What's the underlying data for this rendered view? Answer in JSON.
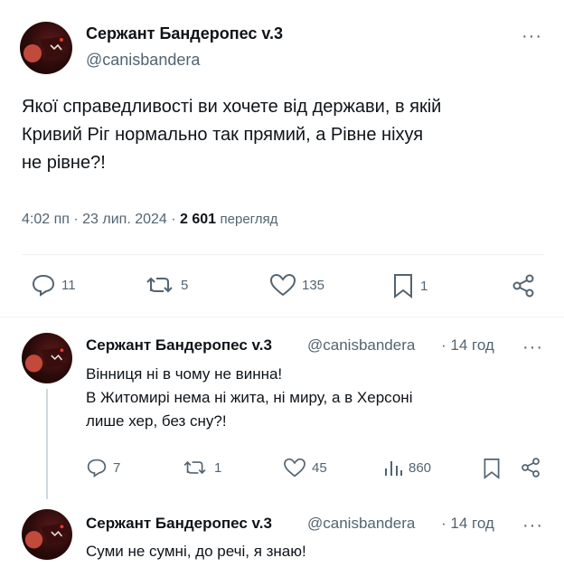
{
  "main_tweet": {
    "name": "Сержант Бандеропес v.3",
    "handle": "@canisbandera",
    "text_lines": [
      "Якої справедливості ви хочете від держави, в якій",
      "Кривий Ріг нормально так прямий, а Рівне ніхуя",
      "не рівне?!"
    ],
    "time": "4:02 пп · 23 лип. 2024 · ",
    "views_count": "2 601",
    "views_label": "перегляд",
    "replies": "11",
    "reposts": "5",
    "likes": "135",
    "bookmarks": "1"
  },
  "replies": [
    {
      "name": "Сержант Бандеропес v.3",
      "handle": "@canisbandera",
      "time": "· 14 год",
      "text_lines": [
        "Вінниця ні в чому не винна!",
        "В Житомирі нема ні жита, ні миру, а в Херсоні",
        "лише хер, без сну?!"
      ],
      "replies": "7",
      "reposts": "1",
      "likes": "45",
      "views": "860"
    },
    {
      "name": "Сержант Бандеропес v.3",
      "handle": "@canisbandera",
      "time": "· 14 год",
      "text_lines": [
        "Суми не сумні, до речі, я знаю!"
      ]
    }
  ],
  "icons": [
    "avatar",
    "more-icon",
    "reply-icon",
    "repost-icon",
    "like-icon",
    "bookmark-icon",
    "share-icon",
    "views-icon"
  ],
  "colors": {
    "text": "#0f1419",
    "secondary": "#536471",
    "divider": "#eff3f4",
    "thread_line": "#cfd9de"
  }
}
